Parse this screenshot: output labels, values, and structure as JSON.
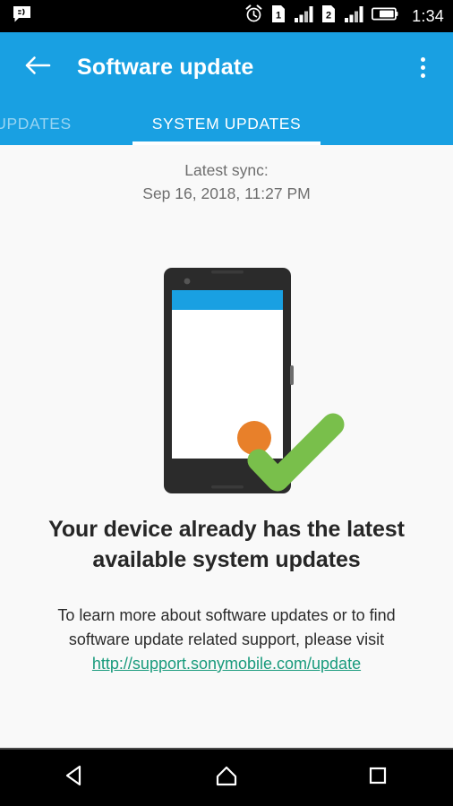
{
  "statusbar": {
    "left_icons": [
      {
        "name": "message-bubble-icon",
        "label": "Messaging notification"
      }
    ],
    "right_icons": [
      {
        "name": "alarm-clock-icon",
        "label": "Alarm set"
      },
      {
        "name": "sim1-icon",
        "label": "1"
      },
      {
        "name": "signal-bars-1-icon",
        "label": "Signal SIM 1"
      },
      {
        "name": "sim2-icon",
        "label": "2"
      },
      {
        "name": "signal-bars-2-icon",
        "label": "Signal SIM 2"
      },
      {
        "name": "battery-icon",
        "label": "Battery"
      }
    ],
    "time": "1:34"
  },
  "appbar": {
    "back_icon": "arrow-left-icon",
    "title": "Software update",
    "overflow_icon": "overflow-menu-icon",
    "background_color": "#19a0e2"
  },
  "tabs": [
    {
      "label": "UPDATES",
      "active": false,
      "name": "tab-app-updates"
    },
    {
      "label": "SYSTEM UPDATES",
      "active": true,
      "name": "tab-system-updates"
    }
  ],
  "content": {
    "sync_label": "Latest sync:",
    "sync_value": "Sep 16, 2018, 11:27 PM",
    "headline": "Your device already has the latest available system updates",
    "body_line1": "To learn more about software updates or to find",
    "body_line2": "software update related support, please visit",
    "link_text": "http://support.sonymobile.com/update",
    "link_color": "#189a7c",
    "illustration": {
      "name": "phone-with-checkmark-illustration",
      "phone_body_color": "#2b2b2b",
      "phone_statusbar_color": "#19a0e2",
      "phone_screen_color": "#ffffff",
      "fab_color": "#e8802a",
      "checkmark_color": "#79bf4b"
    }
  },
  "navbar": {
    "buttons": [
      {
        "name": "nav-back-button",
        "icon": "triangle-back-icon"
      },
      {
        "name": "nav-home-button",
        "icon": "home-icon"
      },
      {
        "name": "nav-recents-button",
        "icon": "square-recents-icon"
      }
    ]
  }
}
